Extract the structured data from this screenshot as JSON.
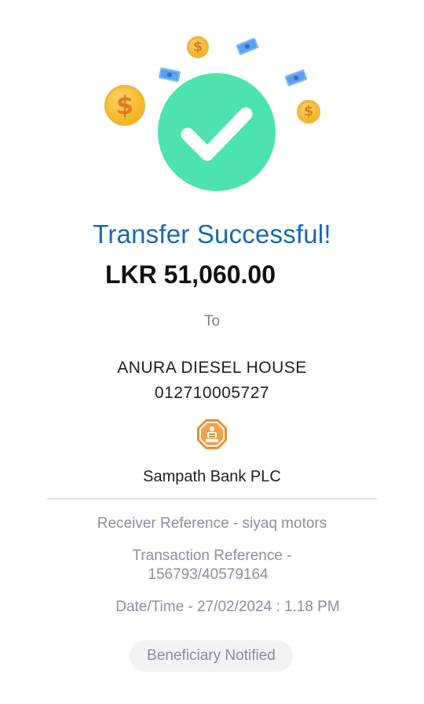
{
  "status": {
    "title": "Transfer Successful!",
    "amount": "LKR 51,060.00"
  },
  "recipient": {
    "to_label": "To",
    "name": "ANURA DIESEL HOUSE",
    "account": "012710005727",
    "bank": "Sampath Bank PLC"
  },
  "details": {
    "receiver_reference": "Receiver Reference - siyaq motors",
    "transaction_reference_label": "Transaction Reference -",
    "transaction_reference_value": "156793/40579164",
    "datetime": "Date/Time -  27/02/2024 : 1.18 PM"
  },
  "notification": {
    "label": "Beneficiary Notified"
  },
  "icons": {
    "coin_symbol": "$",
    "check": "checkmark-icon",
    "bank": "sampath-bank-logo-icon"
  },
  "colors": {
    "success_green": "#4ce3ad",
    "title_blue": "#1569b3",
    "bank_orange": "#f08a24"
  }
}
